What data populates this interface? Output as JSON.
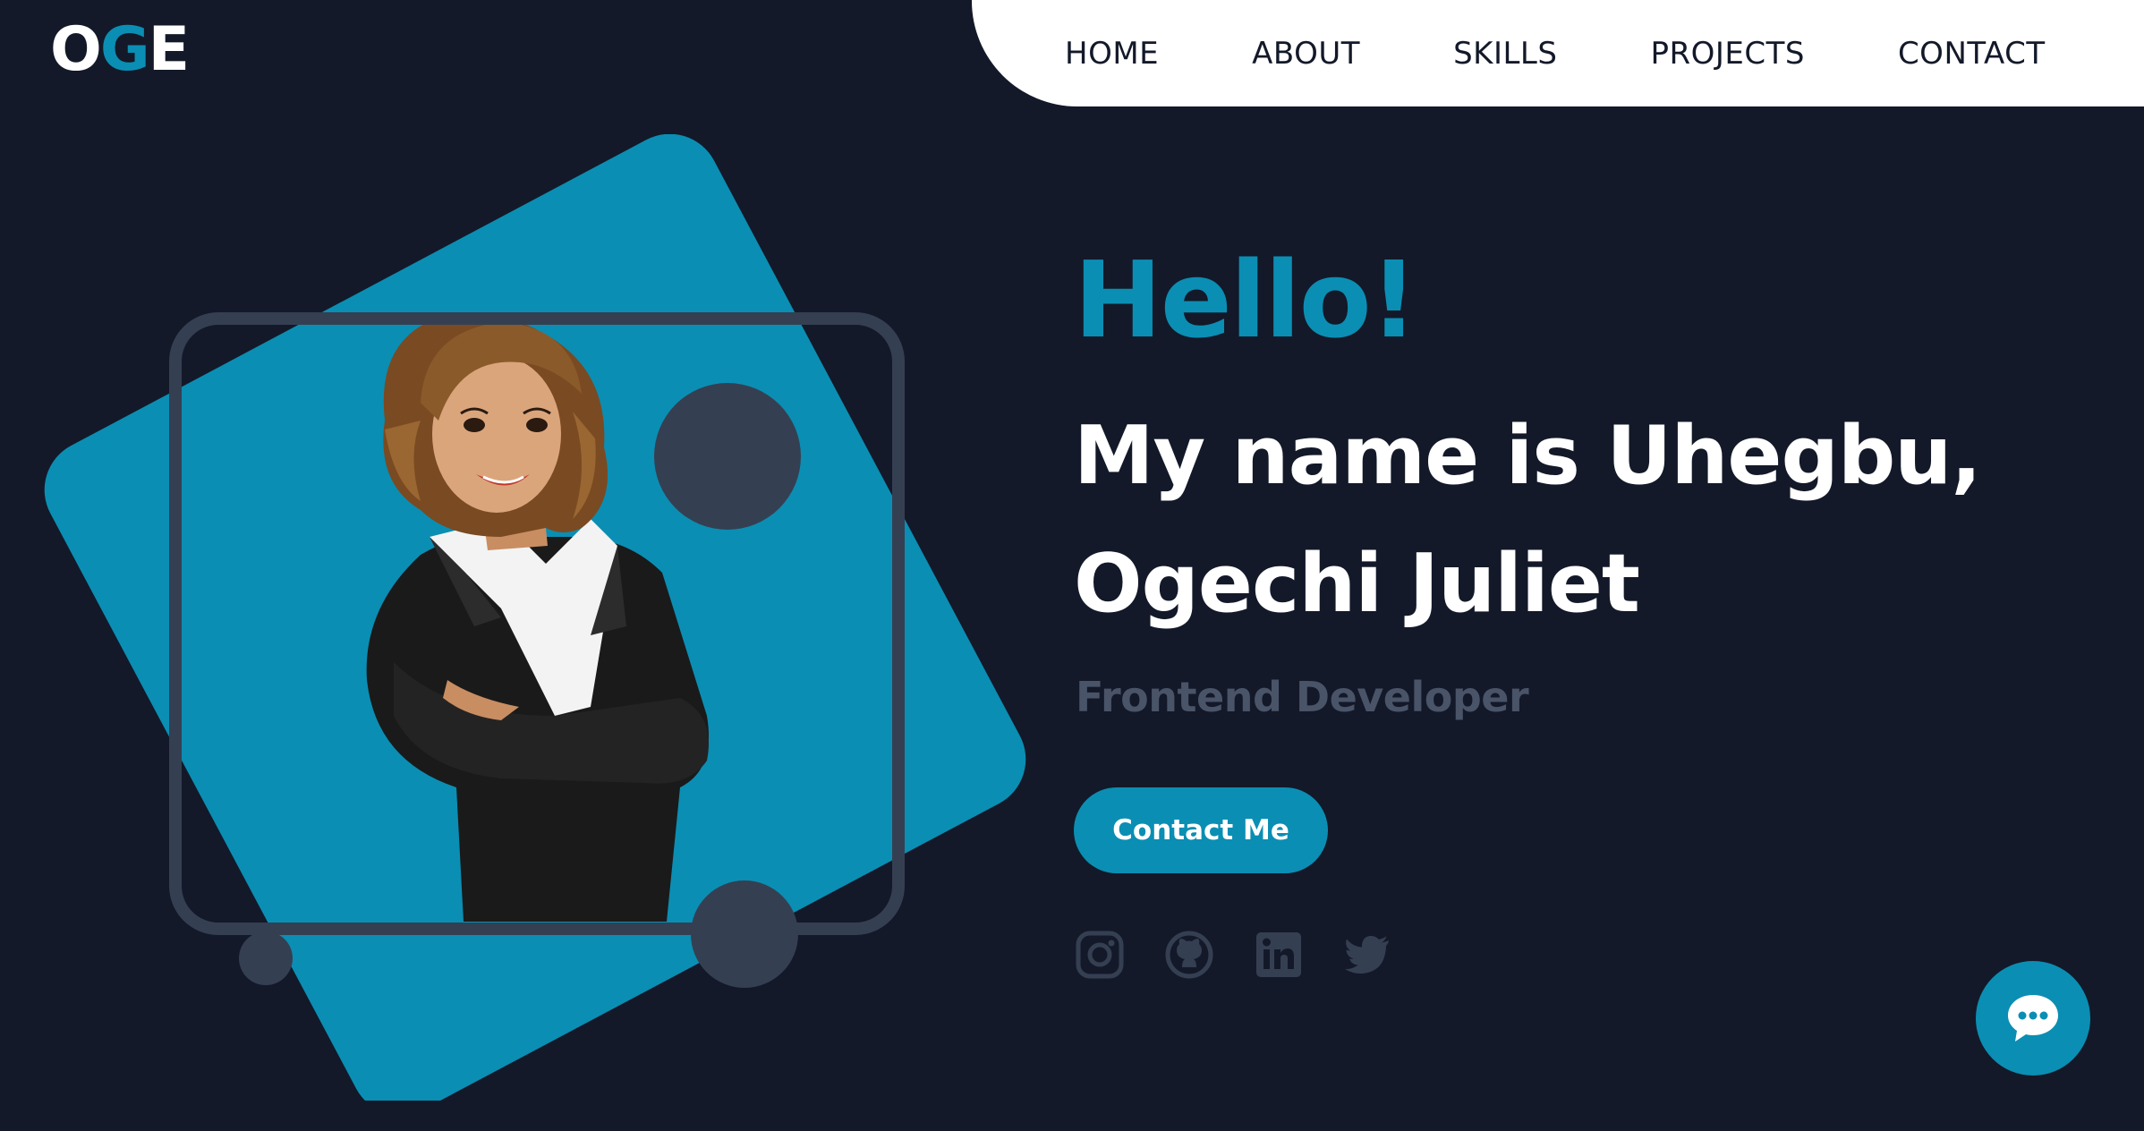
{
  "logo": {
    "part1": "O",
    "part2": "G",
    "part3": "E"
  },
  "nav": {
    "items": [
      "HOME",
      "ABOUT",
      "SKILLS",
      "PROJECTS",
      "CONTACT"
    ]
  },
  "hero": {
    "greeting": "Hello!",
    "name_line1": "My name is Uhegbu,",
    "name_line2": "Ogechi Juliet",
    "role": "Frontend Developer",
    "cta": "Contact Me"
  },
  "socials": [
    "instagram-icon",
    "github-icon",
    "linkedin-icon",
    "twitter-icon"
  ],
  "colors": {
    "background": "#131929",
    "accent": "#0b8eb3",
    "frame": "#353f52",
    "muted_text": "#4a5468",
    "nav_bg": "#ffffff"
  }
}
